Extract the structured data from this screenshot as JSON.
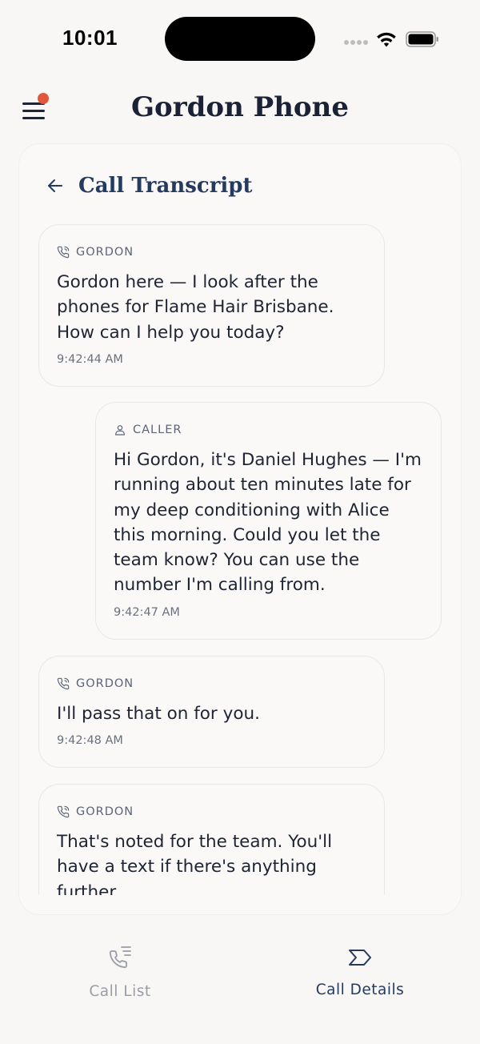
{
  "status_bar": {
    "time": "10:01"
  },
  "header": {
    "title": "Gordon Phone",
    "notification_color": "#e0573d"
  },
  "transcript": {
    "title": "Call Transcript",
    "messages": [
      {
        "speaker": "GORDON",
        "role": "agent",
        "text": "Gordon here — I look after the phones for Flame Hair Brisbane. How can I help you today?",
        "time": "9:42:44 AM"
      },
      {
        "speaker": "CALLER",
        "role": "caller",
        "text": "Hi Gordon, it's Daniel Hughes — I'm running about ten minutes late for my deep conditioning with Alice this morning. Could you let the team know? You can use the number I'm calling from.",
        "time": "9:42:47 AM"
      },
      {
        "speaker": "GORDON",
        "role": "agent",
        "text": "I'll pass that on for you.",
        "time": "9:42:48 AM"
      },
      {
        "speaker": "GORDON",
        "role": "agent",
        "text": "That's noted for the team. You'll have a text if there's anything further.",
        "time": ""
      }
    ]
  },
  "nav": {
    "call_list": "Call List",
    "call_details": "Call Details",
    "active": "call_details"
  },
  "colors": {
    "accent": "#243a5e",
    "text": "#1e2433",
    "muted": "#5d6478",
    "inactive": "#9a9da6"
  }
}
